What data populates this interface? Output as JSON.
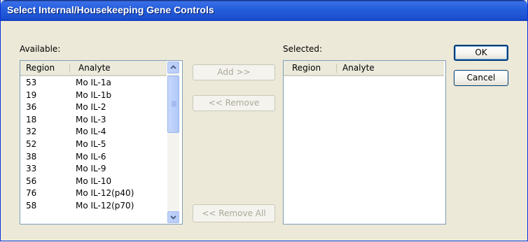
{
  "window": {
    "title": "Select Internal/Housekeeping Gene Controls"
  },
  "available": {
    "label": "Available:",
    "columns": {
      "region": "Region",
      "analyte": "Analyte"
    },
    "rows": [
      {
        "region": "53",
        "analyte": "Mo IL-1a"
      },
      {
        "region": "19",
        "analyte": "Mo IL-1b"
      },
      {
        "region": "36",
        "analyte": "Mo IL-2"
      },
      {
        "region": "18",
        "analyte": "Mo IL-3"
      },
      {
        "region": "32",
        "analyte": "Mo IL-4"
      },
      {
        "region": "52",
        "analyte": "Mo IL-5"
      },
      {
        "region": "38",
        "analyte": "Mo IL-6"
      },
      {
        "region": "33",
        "analyte": "Mo IL-9"
      },
      {
        "region": "56",
        "analyte": "Mo IL-10"
      },
      {
        "region": "76",
        "analyte": "Mo IL-12(p40)"
      },
      {
        "region": "58",
        "analyte": "Mo IL-12(p70)"
      }
    ]
  },
  "selected": {
    "label": "Selected:",
    "columns": {
      "region": "Region",
      "analyte": "Analyte"
    },
    "rows": []
  },
  "buttons": {
    "add": "Add >>",
    "remove": "<< Remove",
    "remove_all": "<< Remove All",
    "ok": "OK",
    "cancel": "Cancel"
  }
}
